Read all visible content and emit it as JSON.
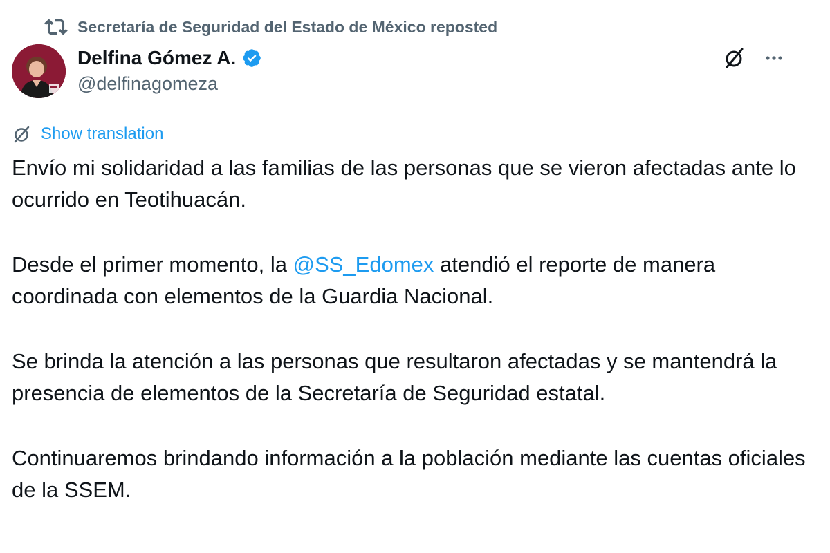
{
  "repost": {
    "icon": "repost-icon",
    "text": "Secretaría de Seguridad del Estado de México reposted"
  },
  "author": {
    "name": "Delfina Gómez A.",
    "handle": "@delfinagomeza",
    "verified": true,
    "verified_color": "#1d9bf0"
  },
  "actions": {
    "grok_icon": "grok-icon",
    "more_icon": "more-icon"
  },
  "translate": {
    "label": "Show translation",
    "icon": "translate-icon"
  },
  "body": {
    "p1": "Envío mi solidaridad a las familias de las personas que se vieron afectadas ante lo ocurrido en Teotihuacán.",
    "p2_before": "Desde el primer momento, la ",
    "p2_mention": "@SS_Edomex",
    "p2_after": " atendió el reporte de manera coordinada con elementos de la Guardia Nacional.",
    "p3": "Se brinda la atención a las personas que resultaron afectadas y se mantendrá la presencia de elementos de la Secretaría de Seguridad estatal.",
    "p4": "Continuaremos brindando información a la población mediante las cuentas oficiales de la SSEM."
  },
  "colors": {
    "text": "#0f1419",
    "secondary": "#536471",
    "link": "#1d9bf0"
  }
}
